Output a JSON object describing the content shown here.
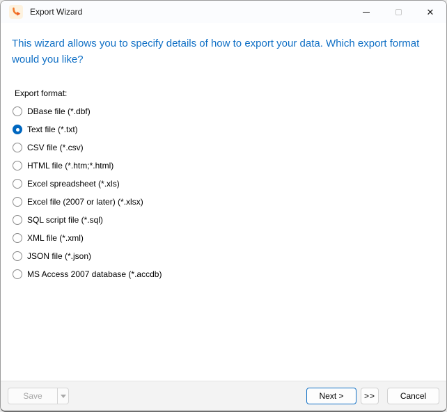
{
  "window": {
    "title": "Export Wizard"
  },
  "icons": {
    "app": "export-curved-arrow",
    "minimize": "–",
    "maximize": "□",
    "close": "✕",
    "save_dropdown": "▼"
  },
  "header": {
    "text": "This wizard allows you to specify details of how to export your data. Which export format would you like?"
  },
  "form": {
    "label": "Export format:",
    "options": [
      {
        "label": "DBase file (*.dbf)",
        "selected": false
      },
      {
        "label": "Text file (*.txt)",
        "selected": true
      },
      {
        "label": "CSV file (*.csv)",
        "selected": false
      },
      {
        "label": "HTML file (*.htm;*.html)",
        "selected": false
      },
      {
        "label": "Excel spreadsheet (*.xls)",
        "selected": false
      },
      {
        "label": "Excel file (2007 or later) (*.xlsx)",
        "selected": false
      },
      {
        "label": "SQL script file (*.sql)",
        "selected": false
      },
      {
        "label": "XML file (*.xml)",
        "selected": false
      },
      {
        "label": "JSON file (*.json)",
        "selected": false
      },
      {
        "label": "MS Access 2007 database (*.accdb)",
        "selected": false
      }
    ]
  },
  "footer": {
    "save_label": "Save",
    "next_label": "Next >",
    "skip_label": ">>",
    "cancel_label": "Cancel"
  },
  "colors": {
    "accent_blue": "#0067c0",
    "header_text_blue": "#0f6fc5",
    "footer_bg": "#f3f3f3",
    "disabled_text": "#a6a6a6"
  }
}
